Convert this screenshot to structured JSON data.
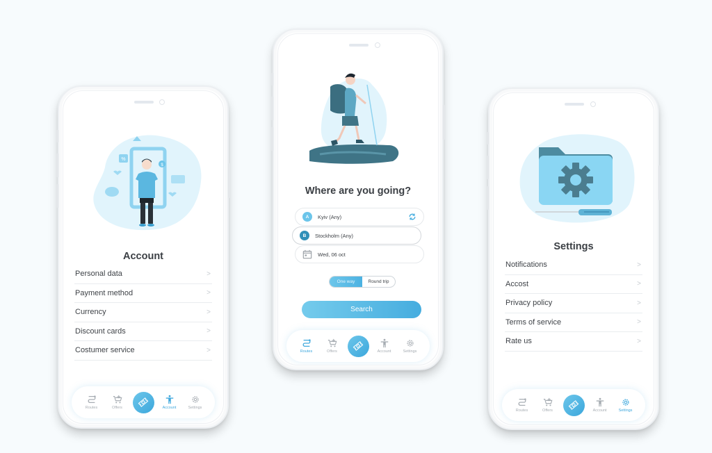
{
  "colors": {
    "accent": "#46addf",
    "accent_light": "#74cbec",
    "blob": "#e1f4fc",
    "badge_a": "#6cc5ea",
    "badge_b": "#2f8fb8",
    "text": "#3e4247",
    "muted": "#a7adb3"
  },
  "account_screen": {
    "illustration": "person-in-phone-frame-illustration",
    "title": "Account",
    "menu": [
      {
        "label": "Personal data",
        "chevron": ">"
      },
      {
        "label": "Payment method",
        "chevron": ">"
      },
      {
        "label": "Currency",
        "chevron": ">"
      },
      {
        "label": "Discount cards",
        "chevron": ">"
      },
      {
        "label": "Costumer service",
        "chevron": ">"
      }
    ],
    "active_tab": "Account"
  },
  "search_screen": {
    "illustration": "hiker-with-backpack-illustration",
    "title": "Where are you going?",
    "from": {
      "badge": "A",
      "value": "Kyiv (Any)",
      "swap_icon": "swap-icon"
    },
    "to": {
      "badge": "B",
      "value": "Stockholm (Any)"
    },
    "date": {
      "icon": "calendar-icon",
      "value": "Wed, 06 oct"
    },
    "trip_type": {
      "options": [
        "One way",
        "Round trip"
      ],
      "selected": "One way"
    },
    "search_label": "Search",
    "active_tab": "Routes"
  },
  "settings_screen": {
    "illustration": "folder-gear-screwdriver-illustration",
    "title": "Settings",
    "menu": [
      {
        "label": "Notifications",
        "chevron": ">"
      },
      {
        "label": "Accost",
        "chevron": ">"
      },
      {
        "label": "Privacy policy",
        "chevron": ">"
      },
      {
        "label": "Terms of service",
        "chevron": ">"
      },
      {
        "label": "Rate us",
        "chevron": ">"
      }
    ],
    "active_tab": "Settings"
  },
  "tabbar": {
    "tabs": [
      {
        "label": "Routes",
        "icon": "routes-icon"
      },
      {
        "label": "Offers",
        "icon": "cart-icon"
      },
      {
        "label": "",
        "icon": "ticket-icon"
      },
      {
        "label": "Account",
        "icon": "person-icon"
      },
      {
        "label": "Settings",
        "icon": "gear-icon"
      }
    ]
  }
}
